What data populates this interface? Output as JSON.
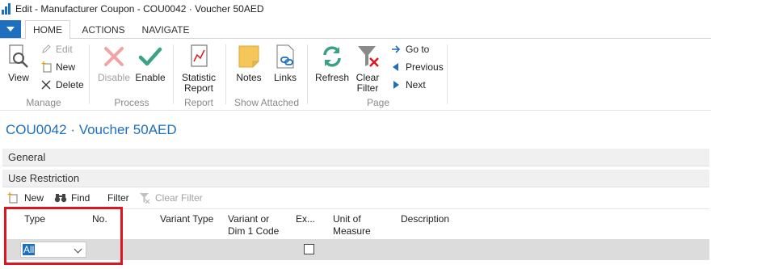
{
  "window": {
    "title": "Edit - Manufacturer Coupon - COU0042 · Voucher 50AED"
  },
  "tabs": [
    {
      "label": "HOME"
    },
    {
      "label": "ACTIONS"
    },
    {
      "label": "NAVIGATE"
    }
  ],
  "ribbon": {
    "manage": {
      "group": "Manage",
      "view": "View",
      "edit": "Edit",
      "new": "New",
      "delete": "Delete"
    },
    "process": {
      "group": "Process",
      "disable": "Disable",
      "enable": "Enable"
    },
    "report": {
      "group": "Report",
      "statistic_line1": "Statistic",
      "statistic_line2": "Report"
    },
    "show_attached": {
      "group": "Show Attached",
      "notes": "Notes",
      "links": "Links"
    },
    "page": {
      "group": "Page",
      "refresh": "Refresh",
      "clear_line1": "Clear",
      "clear_line2": "Filter",
      "goto": "Go to",
      "previous": "Previous",
      "next": "Next"
    }
  },
  "page_title": "COU0042 · Voucher 50AED",
  "fasttabs": {
    "general": "General",
    "use_restriction": "Use Restriction"
  },
  "part_toolbar": {
    "new": "New",
    "find": "Find",
    "filter": "Filter",
    "clear_filter": "Clear Filter"
  },
  "grid": {
    "headers": {
      "type": "Type",
      "no": "No.",
      "variant_type": "Variant Type",
      "variant_line1": "Variant or",
      "variant_line2": "Dim 1 Code",
      "ex": "Ex...",
      "uom_line1": "Unit of",
      "uom_line2": "Measure",
      "description": "Description"
    },
    "row": {
      "type_value": "All",
      "exclude_checked": false
    }
  },
  "colors": {
    "accent": "#1e6fbf",
    "highlight": "#e0141e"
  },
  "icons": [
    "app-icon",
    "menu-dropdown-icon",
    "view-icon",
    "edit-icon",
    "new-icon",
    "delete-icon",
    "disable-icon",
    "enable-icon",
    "statistic-report-icon",
    "notes-icon",
    "links-icon",
    "refresh-icon",
    "clear-filter-icon",
    "goto-arrow-icon",
    "previous-arrow-icon",
    "next-arrow-icon",
    "find-binoculars-icon",
    "chevron-down-icon",
    "checkbox-icon"
  ]
}
